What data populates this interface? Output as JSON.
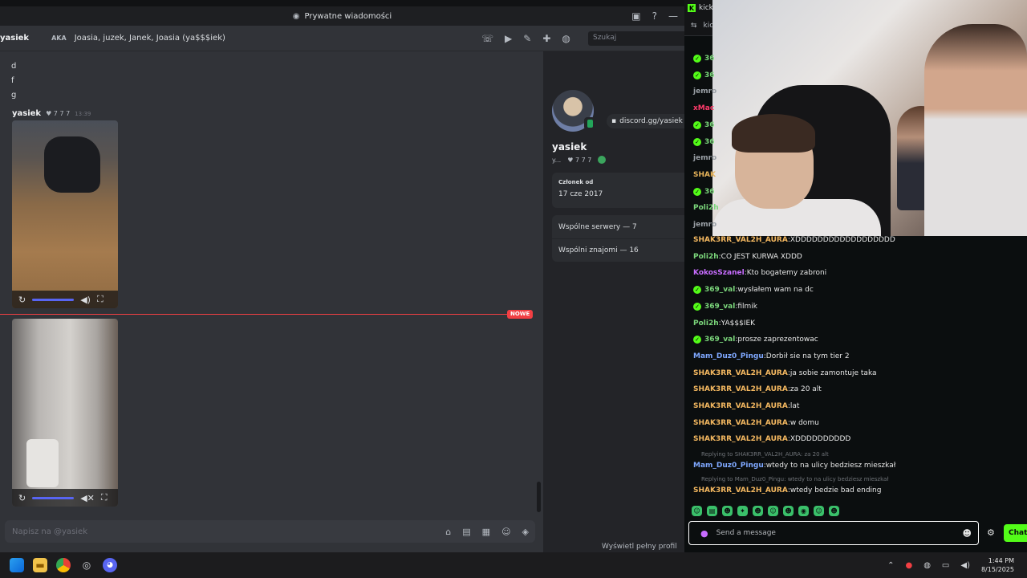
{
  "discord": {
    "titlebar": "Prywatne wiadomości",
    "header": {
      "name": "yasiek",
      "aka_label": "AKA",
      "aka_values": "Joasia, juzek, Janek, Joasia (ya$$$iek)",
      "search_placeholder": "Szukaj"
    },
    "letters": [
      "d",
      "f",
      "g"
    ],
    "message": {
      "author": "yasiek",
      "badge": "♥ 7 7 7",
      "time": "13:39"
    },
    "new_tag": "NOWE",
    "composer_placeholder": "Napisz na @yasiek",
    "profile": {
      "invite": "discord.gg/yasiek",
      "name": "yasiek",
      "tag_short": "y...",
      "badge": "♥ 7 7 7",
      "member_since_label": "Członek od",
      "member_since": "17 cze 2017",
      "mutual_servers": "Wspólne serwery — 7",
      "mutual_friends": "Wspólni znajomi — 16",
      "view_full": "Wyświetl pełny profil"
    }
  },
  "kick": {
    "tab_title": "kick",
    "tab_sub": "kic",
    "colors": {
      "brand": "#53fc18"
    },
    "partial_rows": [
      {
        "user": "36",
        "badge": true,
        "color": "#7bd67b"
      },
      {
        "user": "36",
        "badge": true,
        "color": "#7bd67b"
      },
      {
        "user": "jemro",
        "badge": false,
        "color": "#9aa0a6"
      },
      {
        "user": "xMac",
        "badge": false,
        "color": "#ff3b6b"
      },
      {
        "user": "36",
        "badge": true,
        "color": "#7bd67b"
      },
      {
        "user": "36",
        "badge": true,
        "color": "#7bd67b"
      },
      {
        "user": "jemro",
        "badge": false,
        "color": "#9aa0a6"
      },
      {
        "user": "SHAK",
        "badge": false,
        "color": "#e6b35a"
      },
      {
        "user": "36",
        "badge": true,
        "color": "#7bd67b"
      },
      {
        "user": "Poli2h",
        "badge": false,
        "color": "#7bd67b"
      },
      {
        "user": "jemro",
        "badge": false,
        "color": "#9aa0a6"
      }
    ],
    "messages": [
      {
        "user": "SHAK3RR_VAL2H_AURA",
        "text": "XDDDDDDDDDDDDDDDDDD",
        "badge": false,
        "color": "#f4b860"
      },
      {
        "user": "Poli2h",
        "text": "CO JEST KURWA XDDD",
        "badge": false,
        "color": "#7bd67b"
      },
      {
        "user": "KokosSzanel",
        "text": "Kto bogatemy zabroni",
        "badge": false,
        "color": "#c86dff"
      },
      {
        "user": "369_val",
        "text": "wysłałem wam na dc",
        "badge": true,
        "color": "#7bd67b"
      },
      {
        "user": "369_val",
        "text": "filmik",
        "badge": true,
        "color": "#7bd67b"
      },
      {
        "user": "Poli2h",
        "text": "YA$$$IEK",
        "badge": false,
        "color": "#7bd67b"
      },
      {
        "user": "369_val",
        "text": "prosze zaprezentowac",
        "badge": true,
        "color": "#7bd67b"
      },
      {
        "user": "Mam_Duz0_Pingu",
        "text": "Dorbił sie na tym tier 2",
        "badge": false,
        "color": "#7fa8ff"
      },
      {
        "user": "SHAK3RR_VAL2H_AURA",
        "text": "ja sobie zamontuje taka",
        "badge": false,
        "color": "#f4b860"
      },
      {
        "user": "SHAK3RR_VAL2H_AURA",
        "text": "za 20 alt",
        "badge": false,
        "color": "#f4b860"
      },
      {
        "user": "SHAK3RR_VAL2H_AURA",
        "text": "lat",
        "badge": false,
        "color": "#f4b860"
      },
      {
        "user": "SHAK3RR_VAL2H_AURA",
        "text": "w domu",
        "badge": false,
        "color": "#f4b860"
      },
      {
        "user": "SHAK3RR_VAL2H_AURA",
        "text": "XDDDDDDDDDD",
        "badge": false,
        "color": "#f4b860"
      }
    ],
    "replies": [
      {
        "reply_to": "Replying to SHAK3RR_VAL2H_AURA: za 20 alt",
        "user": "Mam_Duz0_Pingu",
        "text": "wtedy to na ulicy bedziesz mieszkał",
        "color": "#7fa8ff"
      },
      {
        "reply_to": "Replying to Mam_Duz0_Pingu: wtedy to na ulicy bedziesz mieszkał",
        "user": "SHAK3RR_VAL2H_AURA",
        "text": "wtedy bedzie bad ending",
        "color": "#f4b860"
      }
    ],
    "input_placeholder": "Send a message",
    "chat_button": "Chat"
  },
  "taskbar": {
    "time": "1:44 PM",
    "date": "8/15/2025"
  }
}
